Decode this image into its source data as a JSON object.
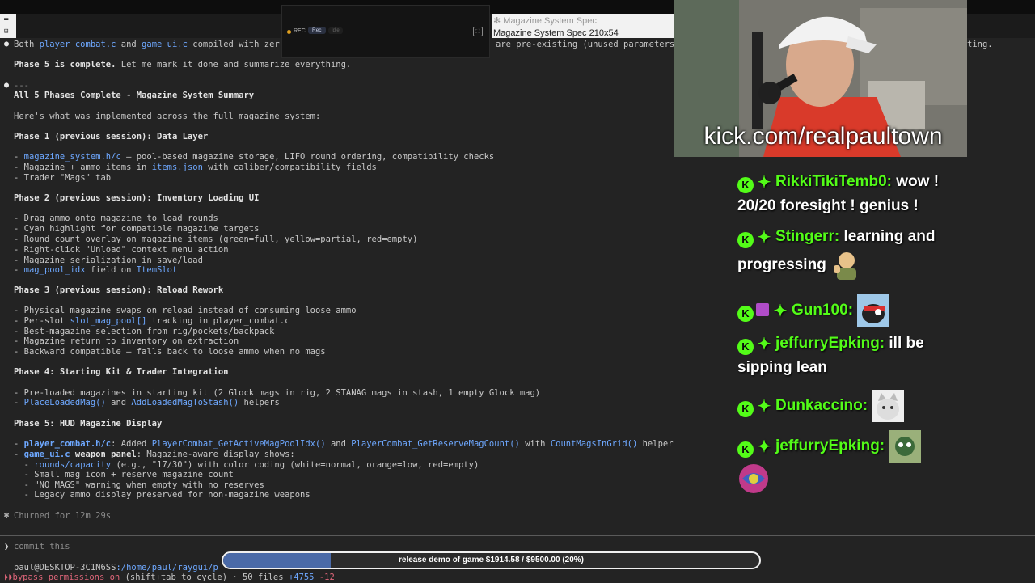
{
  "recorder": {
    "rec_label": "REC",
    "button": "Rec",
    "state": "Idle"
  },
  "spec_window": {
    "tab_title": "Magazine System Spec",
    "subtitle": "Magazine System Spec 210x54"
  },
  "terminal": {
    "line0_a": "Both ",
    "line0_f1": "player_combat.c",
    "line0_b": " and ",
    "line0_f2": "game_ui.c",
    "line0_c": " compiled with zer",
    "line0_ghost": "are pre-existing (unused parameters",
    "line0_right": "ting.",
    "phase5_done_bold": "Phase 5 is complete.",
    "phase5_done_rest": " Let me mark it done and summarize everything.",
    "sep": "---",
    "heading": "All 5 Phases Complete - Magazine System Summary",
    "intro": "Here's what was implemented across the full magazine system:",
    "p1_title": "Phase 1 (previous session): Data Layer",
    "p1_i1_code": "magazine_system.h/c",
    "p1_i1_text": " — pool-based magazine storage, LIFO round ordering, compatibility checks",
    "p1_i2_a": "Magazine + ammo items in ",
    "p1_i2_code": "items.json",
    "p1_i2_b": " with caliber/compatibility fields",
    "p1_i3": "Trader \"Mags\" tab",
    "p2_title": "Phase 2 (previous session): Inventory Loading UI",
    "p2_i1": "Drag ammo onto magazine to load rounds",
    "p2_i2": "Cyan highlight for compatible magazine targets",
    "p2_i3": "Round count overlay on magazine items (green=full, yellow=partial, red=empty)",
    "p2_i4": "Right-click \"Unload\" context menu action",
    "p2_i5": "Magazine serialization in save/load",
    "p2_i6_code": "mag_pool_idx",
    "p2_i6_a": " field on ",
    "p2_i6_code2": "ItemSlot",
    "p3_title": "Phase 3 (previous session): Reload Rework",
    "p3_i1": "Physical magazine swaps on reload instead of consuming loose ammo",
    "p3_i2_a": "Per-slot ",
    "p3_i2_code": "slot_mag_pool[]",
    "p3_i2_b": " tracking in player_combat.c",
    "p3_i3": "Best-magazine selection from rig/pockets/backpack",
    "p3_i4": "Magazine return to inventory on extraction",
    "p3_i5": "Backward compatible — falls back to loose ammo when no mags",
    "p4_title": "Phase 4: Starting Kit & Trader Integration",
    "p4_i1": "Pre-loaded magazines in starting kit (2 Glock mags in rig, 2 STANAG mags in stash, 1 empty Glock mag)",
    "p4_i2_code": "PlaceLoadedMag()",
    "p4_i2_a": " and ",
    "p4_i2_code2": "AddLoadedMagToStash()",
    "p4_i2_b": " helpers",
    "p5_title": "Phase 5: HUD Magazine Display",
    "p5_i1_code": "player_combat.h/c",
    "p5_i1_a": ": Added ",
    "p5_i1_c2": "PlayerCombat_GetActiveMagPoolIdx()",
    "p5_i1_b": " and ",
    "p5_i1_c3": "PlayerCombat_GetReserveMagCount()",
    "p5_i1_c": " with ",
    "p5_i1_c4": "CountMagsInGrid()",
    "p5_i1_d": " helper",
    "p5_i2_code": "game_ui.c",
    "p5_i2_bold": " weapon panel",
    "p5_i2_rest": ": Magazine-aware display shows:",
    "p5_s1_code": "rounds/capacity",
    "p5_s1_rest": " (e.g., \"17/30\") with color coding (white=normal, orange=low, red=empty)",
    "p5_s2": "Small mag icon + reserve magazine count",
    "p5_s3": "\"NO MAGS\" warning when empty with no reserves",
    "p5_s4": "Legacy ammo display preserved for non-magazine weapons",
    "churned": "Churned for 12m 29s"
  },
  "prompt": {
    "caret": "❯",
    "value": "commit this"
  },
  "status": {
    "user_host": "paul@DESKTOP-3C1N6SS",
    "path": ":/home/paul/raygui/p",
    "mode_icon": "⏵⏵",
    "mode": "bypass permissions on",
    "hint": " (shift+tab to cycle) · ",
    "files": "50 files ",
    "added": "+4755",
    "removed": "-12"
  },
  "donation": {
    "label": "release demo of game $1914.58 / $9500.00 (20%)",
    "progress": 0.2
  },
  "stream": {
    "url": "kick.com/realpaultown"
  },
  "chat": [
    {
      "user": "RikkiTikiTemb0:",
      "text": " wow ! 20/20 foresight ! genius !"
    },
    {
      "user": "Stingerr:",
      "text": " learning and progressing"
    },
    {
      "user": "Gun100:",
      "text": ""
    },
    {
      "user": "jeffurryEpking:",
      "text": " ill be sipping lean"
    },
    {
      "user": "Dunkaccino:",
      "text": ""
    },
    {
      "user": "jeffurryEpking:",
      "text": ""
    }
  ],
  "colors": {
    "kick_green": "#53fc18",
    "code_blue": "#6ea8ff",
    "terminal_bg": "#232323"
  }
}
